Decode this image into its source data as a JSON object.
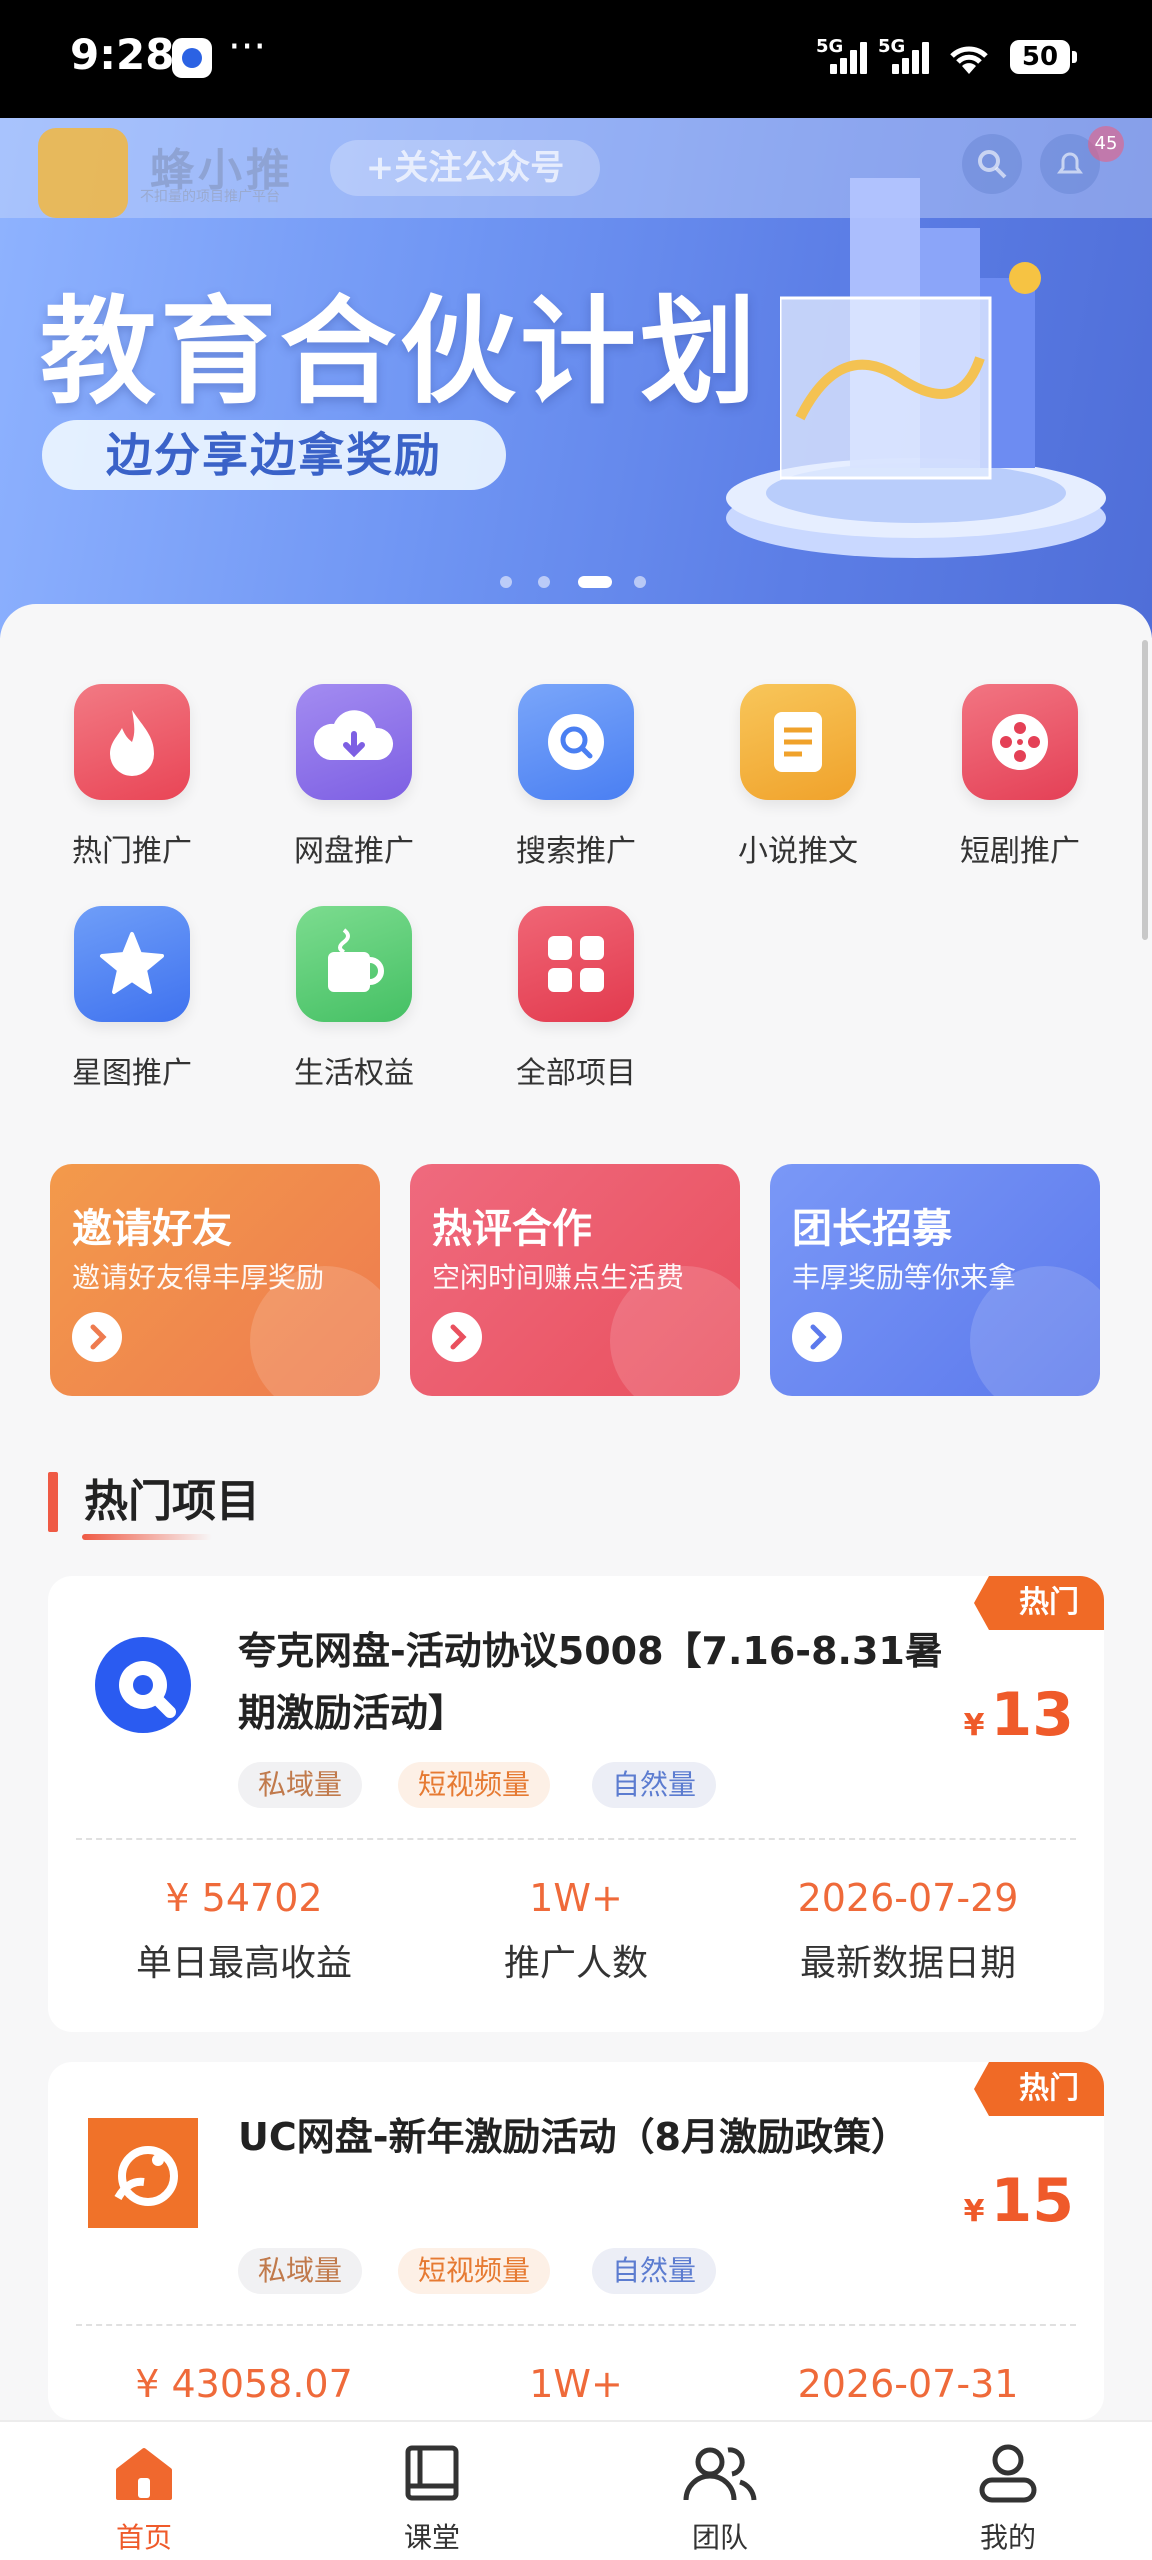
{
  "status_bar": {
    "time": "9:28",
    "more": "···",
    "net1": "5G",
    "net2": "5G",
    "battery": "50"
  },
  "banner": {
    "logo_text": "蜂小推",
    "logo_sub": "不扣量的项目推广平台",
    "follow_label": "+关注公众号",
    "notif_count": "45",
    "title": "教育合伙计划",
    "subtitle": "边分享边拿奖励",
    "page_count": 4,
    "active_page": 3
  },
  "categories": [
    {
      "label": "热门推广",
      "icon": "fire-icon",
      "color": "#ef5866"
    },
    {
      "label": "网盘推广",
      "icon": "cloud-download-icon",
      "color": "#8d70ea"
    },
    {
      "label": "搜索推广",
      "icon": "search-icon",
      "color": "#5a8ef5"
    },
    {
      "label": "小说推文",
      "icon": "document-icon",
      "color": "#f5b23c"
    },
    {
      "label": "短剧推广",
      "icon": "film-reel-icon",
      "color": "#ec5366"
    },
    {
      "label": "星图推广",
      "icon": "star-icon",
      "color": "#4d85f3"
    },
    {
      "label": "生活权益",
      "icon": "coffee-cup-icon",
      "color": "#5bcf78"
    },
    {
      "label": "全部项目",
      "icon": "grid-icon",
      "color": "#ec4c5e"
    }
  ],
  "promos": [
    {
      "title": "邀请好友",
      "subtitle": "邀请好友得丰厚奖励",
      "color_from": "#f39a4b",
      "color_to": "#ee7b4f"
    },
    {
      "title": "热评合作",
      "subtitle": "空闲时间赚点生活费",
      "color_from": "#ef6a7e",
      "color_to": "#e9505e"
    },
    {
      "title": "团长招募",
      "subtitle": "丰厚奖励等你来拿",
      "color_from": "#6f8ff5",
      "color_to": "#5c79ec"
    }
  ],
  "section": {
    "title": "热门项目"
  },
  "projects": [
    {
      "hot_label": "热门",
      "title": "夸克网盘-活动协议5008【7.16-8.31暑期激励活动】",
      "price_symbol": "¥",
      "price": "13",
      "tags": [
        "私域量",
        "短视频量",
        "自然量"
      ],
      "stats": [
        {
          "value": "¥ 54702",
          "label": "单日最高收益"
        },
        {
          "value": "1W+",
          "label": "推广人数"
        },
        {
          "value": "2026-07-29",
          "label": "最新数据日期"
        }
      ],
      "logo": "quark-logo-icon"
    },
    {
      "hot_label": "热门",
      "title": "UC网盘-新年激励活动（8月激励政策）",
      "price_symbol": "¥",
      "price": "15",
      "tags": [
        "私域量",
        "短视频量",
        "自然量"
      ],
      "stats": [
        {
          "value": "¥ 43058.07",
          "label": ""
        },
        {
          "value": "1W+",
          "label": ""
        },
        {
          "value": "2026-07-31",
          "label": ""
        }
      ],
      "logo": "uc-logo-icon"
    }
  ],
  "tabbar": [
    {
      "label": "首页",
      "icon": "home-icon",
      "active": true
    },
    {
      "label": "课堂",
      "icon": "book-icon",
      "active": false
    },
    {
      "label": "团队",
      "icon": "team-icon",
      "active": false
    },
    {
      "label": "我的",
      "icon": "user-icon",
      "active": false
    }
  ],
  "colors": {
    "accent": "#ef5a2a",
    "hot": "#f06a26"
  }
}
